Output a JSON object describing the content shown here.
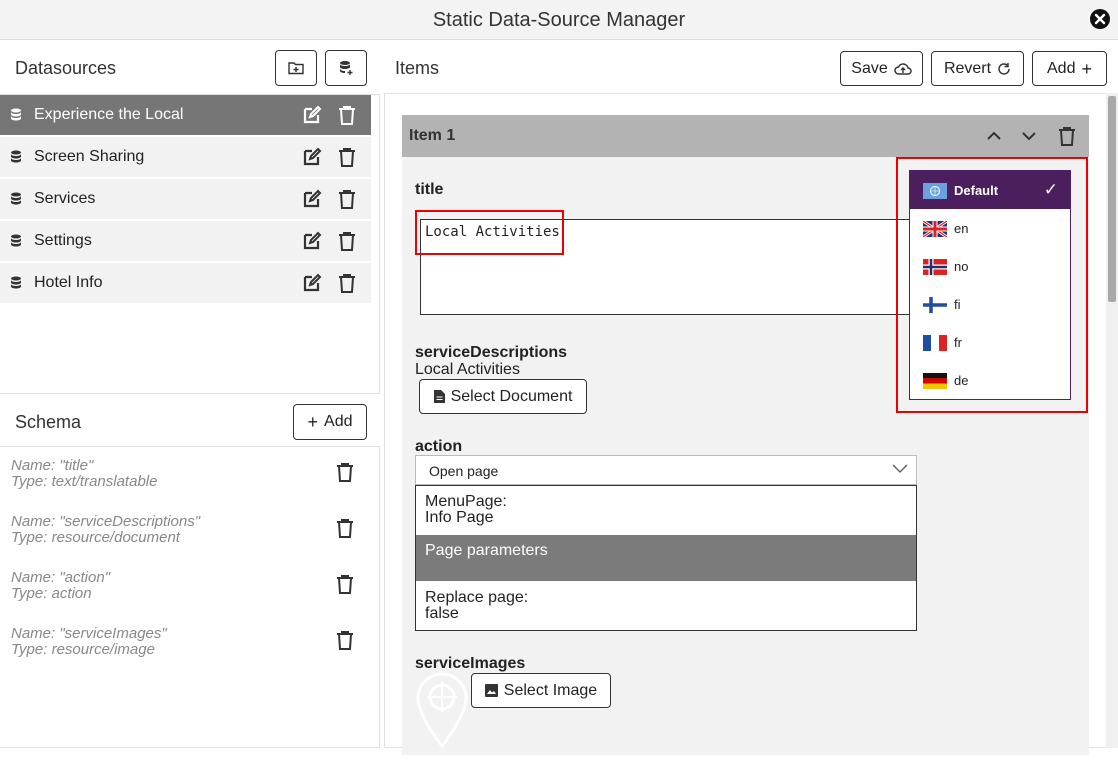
{
  "window": {
    "title": "Static Data-Source Manager"
  },
  "datasources": {
    "title": "Datasources",
    "items": [
      {
        "label": "Experience the Local",
        "selected": true
      },
      {
        "label": "Screen Sharing"
      },
      {
        "label": "Services"
      },
      {
        "label": "Settings"
      },
      {
        "label": "Hotel Info"
      }
    ]
  },
  "schema": {
    "title": "Schema",
    "add_label": "Add",
    "fields": [
      {
        "name": "Name: \"title\"",
        "type": "Type: text/translatable"
      },
      {
        "name": "Name: \"serviceDescriptions\"",
        "type": "Type: resource/document"
      },
      {
        "name": "Name: \"action\"",
        "type": "Type: action"
      },
      {
        "name": "Name: \"serviceImages\"",
        "type": "Type: resource/image"
      }
    ]
  },
  "items_panel": {
    "title": "Items",
    "save_label": "Save",
    "revert_label": "Revert",
    "add_label": "Add"
  },
  "item": {
    "header": "Item 1",
    "title_label": "title",
    "title_value": "Local Activities",
    "service_desc_label": "serviceDescriptions",
    "service_desc_value": "Local Activities",
    "select_document_label": "Select Document",
    "action_label": "action",
    "action_selected": "Open page",
    "action_rows": [
      {
        "line1": "MenuPage:",
        "line2": "Info Page"
      },
      {
        "line1": "Page parameters",
        "line2": ""
      },
      {
        "line1": "Replace page:",
        "line2": "false"
      }
    ],
    "service_images_label": "serviceImages",
    "select_image_label": "Select Image"
  },
  "languages": {
    "selected": "Default",
    "options": [
      {
        "code": "Default",
        "flag": "un-flag-icon"
      },
      {
        "code": "en",
        "flag": "uk-flag-icon"
      },
      {
        "code": "no",
        "flag": "norway-flag-icon"
      },
      {
        "code": "fi",
        "flag": "finland-flag-icon"
      },
      {
        "code": "fr",
        "flag": "france-flag-icon"
      },
      {
        "code": "de",
        "flag": "germany-flag-icon"
      }
    ]
  },
  "colors": {
    "selected_row": "#767676",
    "language_active": "#4b1f5e",
    "highlight_red": "#e00000"
  }
}
